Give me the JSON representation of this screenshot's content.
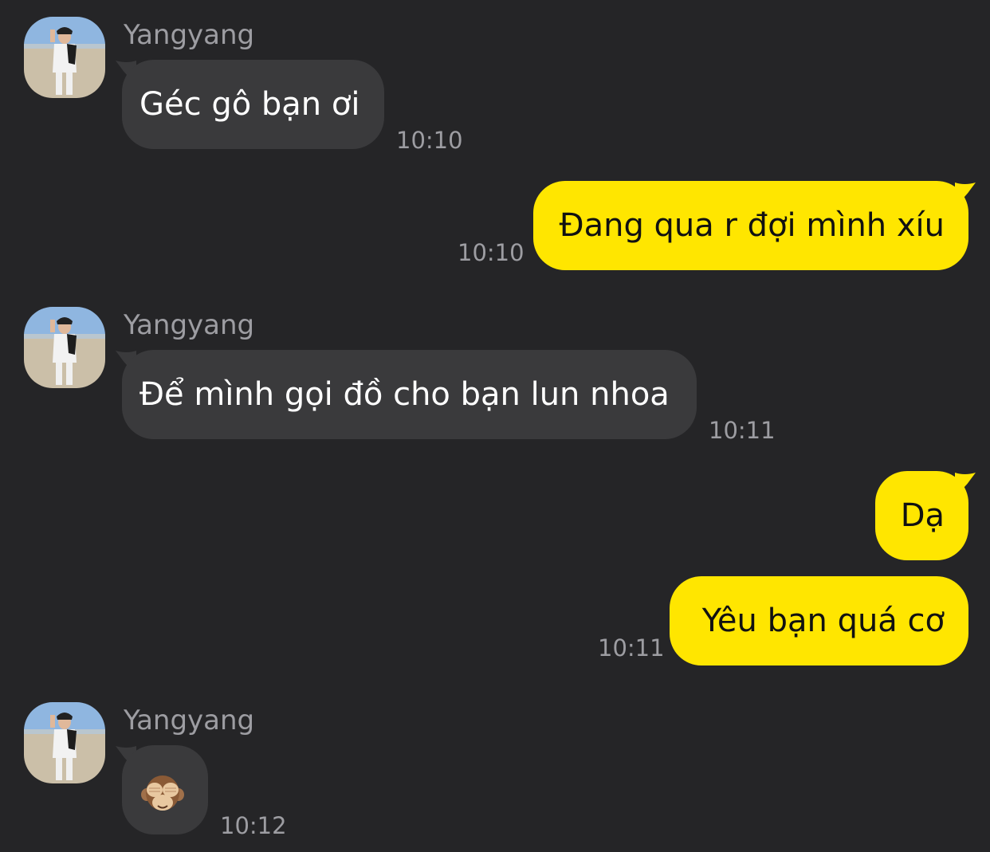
{
  "colors": {
    "background": "#252527",
    "incoming_bubble": "#3a3a3c",
    "outgoing_bubble": "#ffe600",
    "meta_text": "#9d9da2"
  },
  "messages": [
    {
      "sender": "Yangyang",
      "text": "Géc gô bạn ơi",
      "time": "10:10",
      "direction": "incoming"
    },
    {
      "text": "Đang qua r đợi mình xíu",
      "time": "10:10",
      "direction": "outgoing"
    },
    {
      "sender": "Yangyang",
      "text": "Để mình gọi đồ cho bạn lun nhoa",
      "time": "10:11",
      "direction": "incoming"
    },
    {
      "text": "Dạ",
      "direction": "outgoing"
    },
    {
      "text": "Yêu bạn quá cơ",
      "time": "10:11",
      "direction": "outgoing"
    },
    {
      "sender": "Yangyang",
      "icon": "see-no-evil-monkey-icon",
      "time": "10:12",
      "direction": "incoming"
    }
  ]
}
